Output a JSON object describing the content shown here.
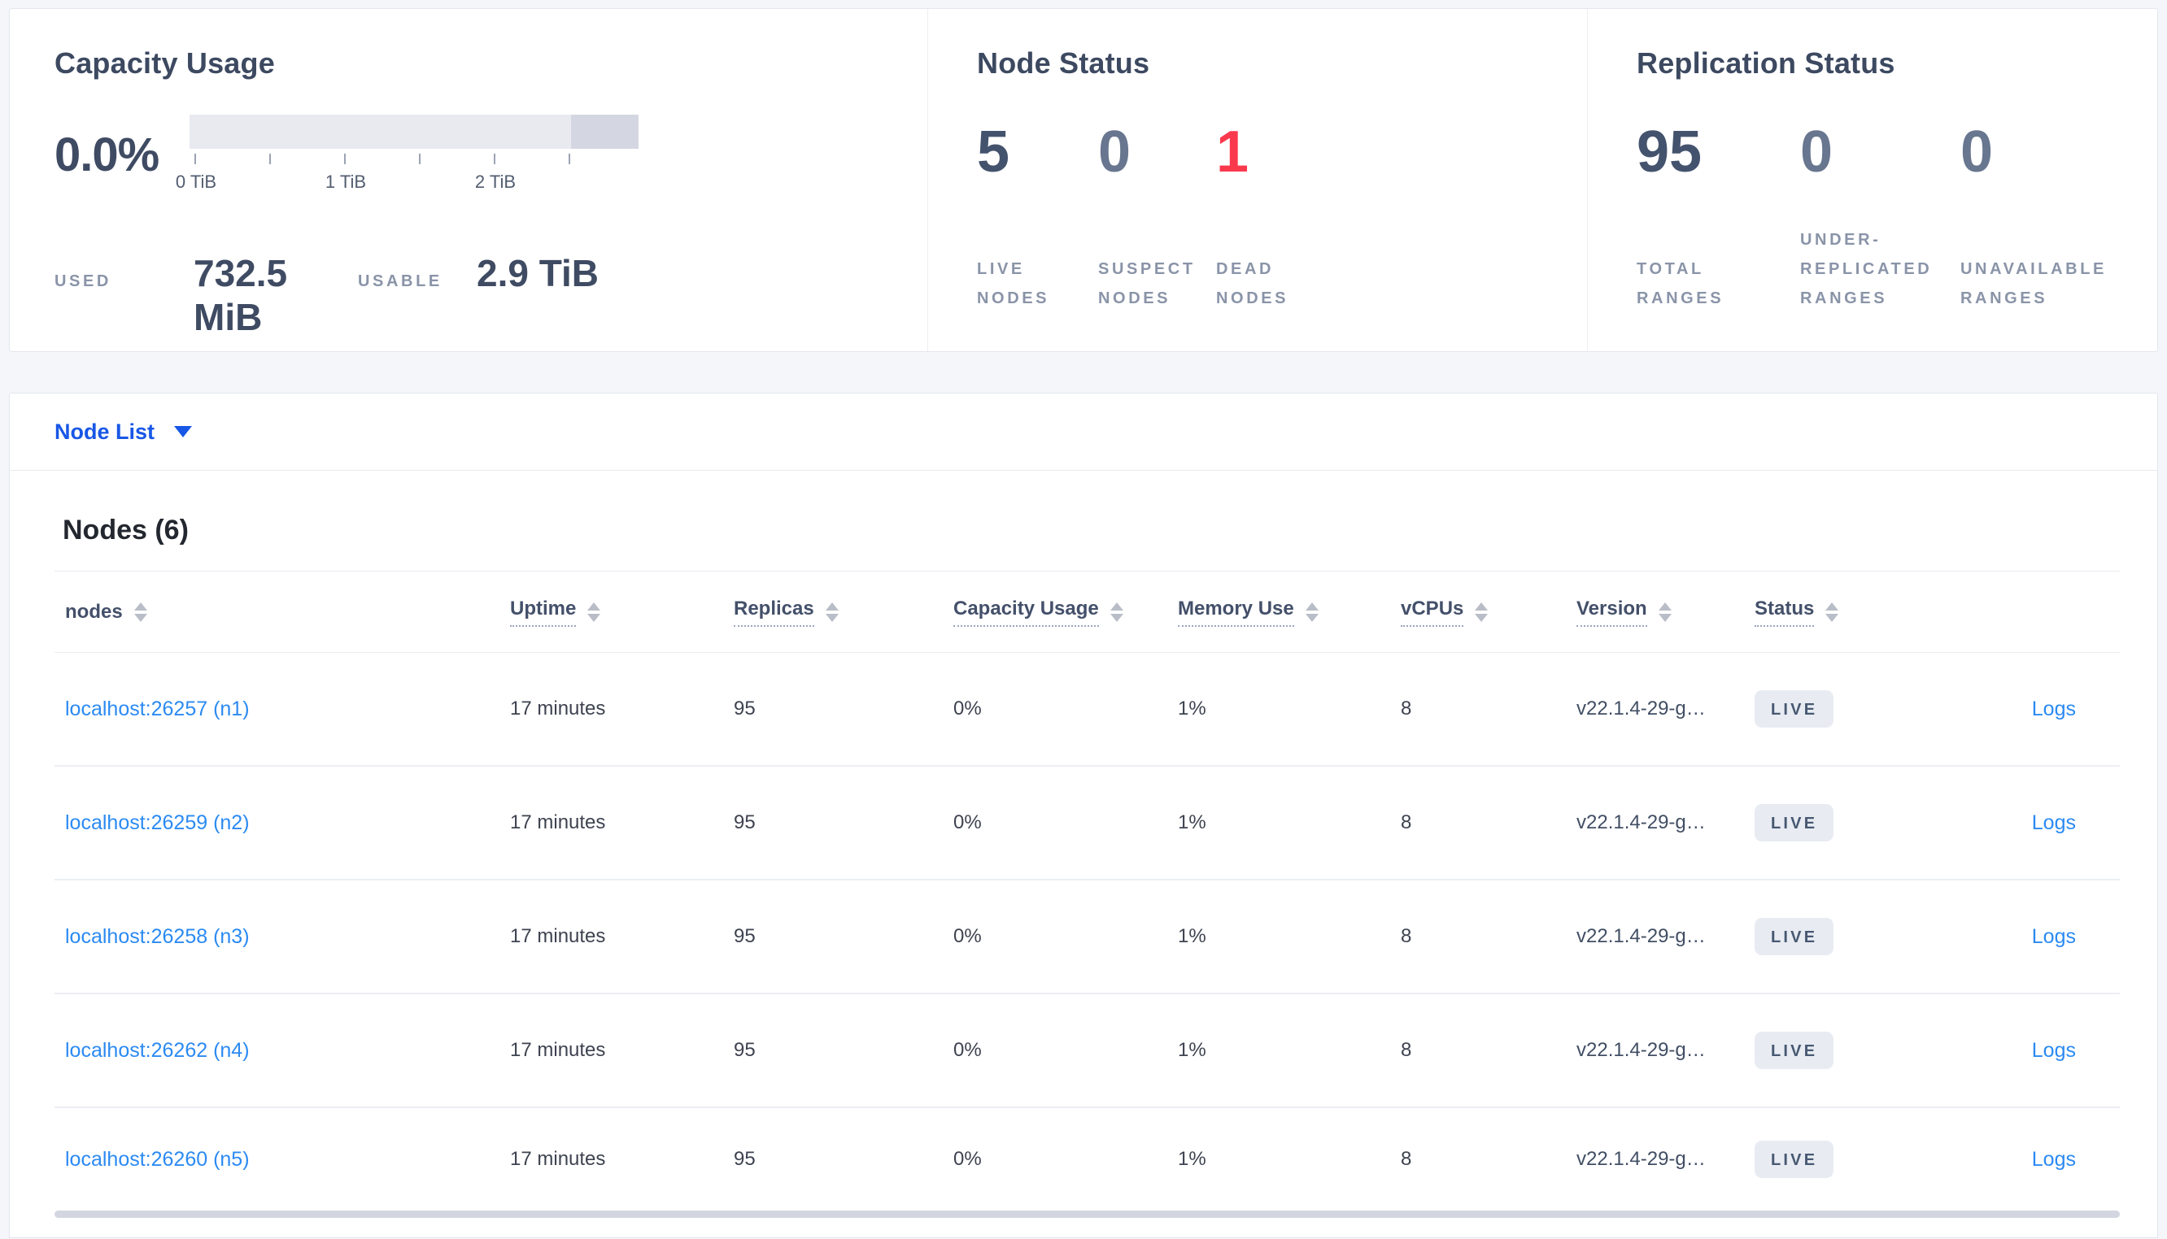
{
  "colors": {
    "accent_blue": "#1857e6",
    "link_blue": "#2b8af2",
    "dead_red": "#fb394d",
    "dark_number": "#44536d",
    "muted_number": "#68768f",
    "badge_bg": "#e8ecf2",
    "bar_light": "#e8eaf0",
    "bar_dark": "#d4d7e1"
  },
  "summary": {
    "capacity": {
      "title": "Capacity Usage",
      "percent": "0.0%",
      "tick_labels": [
        "0 TiB",
        "1 TiB",
        "2 TiB"
      ],
      "axis_max": "2.9 TiB",
      "used_label": "USED",
      "used_value": "732.5 MiB",
      "usable_label": "USABLE",
      "usable_value": "2.9 TiB"
    },
    "node_status": {
      "title": "Node Status",
      "stats": [
        {
          "value": "5",
          "label": "LIVE NODES",
          "tone": "dark"
        },
        {
          "value": "0",
          "label": "SUSPECT NODES",
          "tone": "muted"
        },
        {
          "value": "1",
          "label": "DEAD NODES",
          "tone": "red"
        }
      ]
    },
    "replication": {
      "title": "Replication Status",
      "stats": [
        {
          "value": "95",
          "label": "TOTAL RANGES",
          "tone": "dark"
        },
        {
          "value": "0",
          "label": "UNDER-REPLICATED RANGES",
          "tone": "muted"
        },
        {
          "value": "0",
          "label": "UNAVAILABLE RANGES",
          "tone": "muted"
        }
      ]
    }
  },
  "view_selector": {
    "label": "Node List"
  },
  "nodes_section": {
    "heading": "Nodes (6)",
    "columns": [
      {
        "label": "nodes",
        "key": "node",
        "type": "link",
        "sortable": true,
        "underline": false
      },
      {
        "label": "Uptime",
        "key": "uptime",
        "type": "text",
        "sortable": true,
        "underline": true
      },
      {
        "label": "Replicas",
        "key": "replicas",
        "type": "text",
        "sortable": true,
        "underline": true
      },
      {
        "label": "Capacity Usage",
        "key": "capacity_usage",
        "type": "text",
        "sortable": true,
        "underline": true
      },
      {
        "label": "Memory Use",
        "key": "memory_use",
        "type": "text",
        "sortable": true,
        "underline": true
      },
      {
        "label": "vCPUs",
        "key": "vcpus",
        "type": "text",
        "sortable": true,
        "underline": true
      },
      {
        "label": "Version",
        "key": "version",
        "type": "version",
        "sortable": true,
        "underline": true
      },
      {
        "label": "Status",
        "key": "status",
        "type": "badge",
        "sortable": true,
        "underline": true
      },
      {
        "label": "",
        "key": "logs",
        "type": "logs-link",
        "sortable": false,
        "underline": false
      }
    ],
    "rows": [
      {
        "node": "localhost:26257 (n1)",
        "uptime": "17 minutes",
        "replicas": "95",
        "capacity_usage": "0%",
        "memory_use": "1%",
        "vcpus": "8",
        "version": "v22.1.4-29-g…",
        "status": "LIVE",
        "logs": "Logs"
      },
      {
        "node": "localhost:26259 (n2)",
        "uptime": "17 minutes",
        "replicas": "95",
        "capacity_usage": "0%",
        "memory_use": "1%",
        "vcpus": "8",
        "version": "v22.1.4-29-g…",
        "status": "LIVE",
        "logs": "Logs"
      },
      {
        "node": "localhost:26258 (n3)",
        "uptime": "17 minutes",
        "replicas": "95",
        "capacity_usage": "0%",
        "memory_use": "1%",
        "vcpus": "8",
        "version": "v22.1.4-29-g…",
        "status": "LIVE",
        "logs": "Logs"
      },
      {
        "node": "localhost:26262 (n4)",
        "uptime": "17 minutes",
        "replicas": "95",
        "capacity_usage": "0%",
        "memory_use": "1%",
        "vcpus": "8",
        "version": "v22.1.4-29-g…",
        "status": "LIVE",
        "logs": "Logs"
      },
      {
        "node": "localhost:26260 (n5)",
        "uptime": "17 minutes",
        "replicas": "95",
        "capacity_usage": "0%",
        "memory_use": "1%",
        "vcpus": "8",
        "version": "v22.1.4-29-g…",
        "status": "LIVE",
        "logs": "Logs"
      }
    ]
  }
}
